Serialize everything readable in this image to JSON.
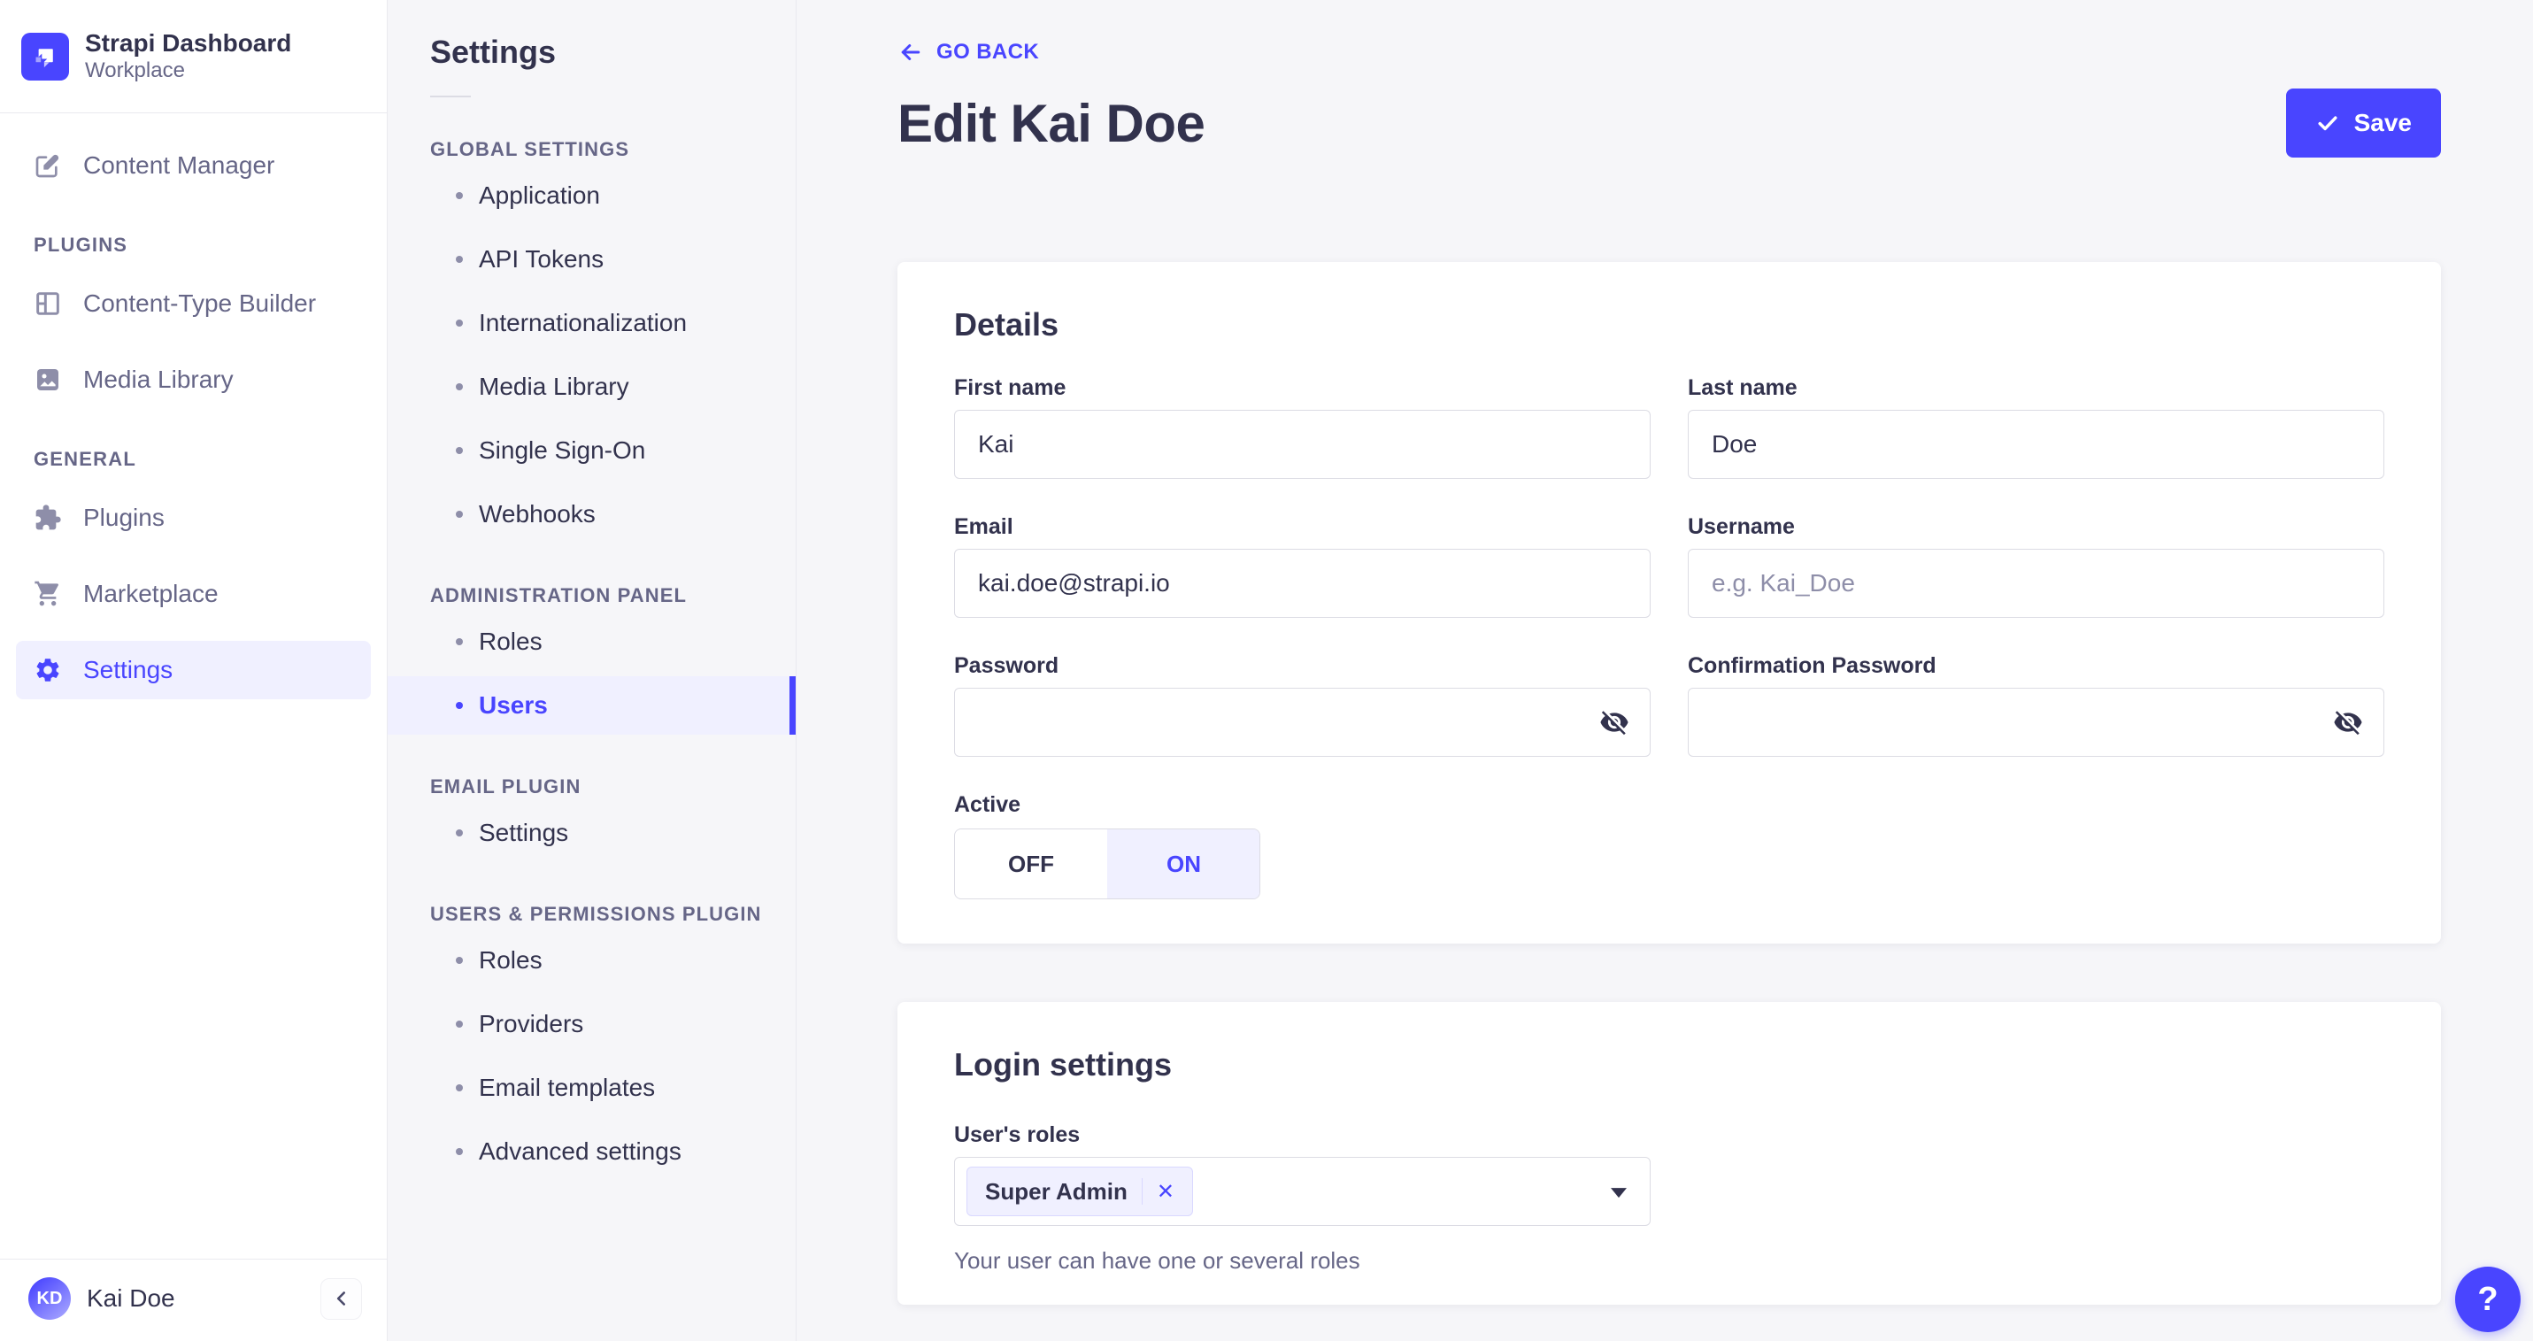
{
  "colors": {
    "primary": "#4945ff",
    "primary_light": "#f0f0ff",
    "text_dark": "#32324d",
    "text_muted": "#666687",
    "border": "#dcdce4",
    "background": "#f6f6f9"
  },
  "brand": {
    "title": "Strapi Dashboard",
    "subtitle": "Workplace"
  },
  "sidebar": {
    "content_manager": "Content Manager",
    "sections": [
      {
        "title": "PLUGINS",
        "items": [
          {
            "label": "Content-Type Builder"
          },
          {
            "label": "Media Library"
          }
        ]
      },
      {
        "title": "GENERAL",
        "items": [
          {
            "label": "Plugins"
          },
          {
            "label": "Marketplace"
          },
          {
            "label": "Settings",
            "active": true
          }
        ]
      }
    ],
    "user": {
      "initials": "KD",
      "name": "Kai Doe"
    }
  },
  "subnav": {
    "title": "Settings",
    "groups": [
      {
        "title": "GLOBAL SETTINGS",
        "items": [
          {
            "label": "Application"
          },
          {
            "label": "API Tokens"
          },
          {
            "label": "Internationalization"
          },
          {
            "label": "Media Library"
          },
          {
            "label": "Single Sign-On"
          },
          {
            "label": "Webhooks"
          }
        ]
      },
      {
        "title": "ADMINISTRATION PANEL",
        "items": [
          {
            "label": "Roles"
          },
          {
            "label": "Users",
            "active": true
          }
        ]
      },
      {
        "title": "EMAIL PLUGIN",
        "items": [
          {
            "label": "Settings"
          }
        ]
      },
      {
        "title": "USERS & PERMISSIONS PLUGIN",
        "items": [
          {
            "label": "Roles"
          },
          {
            "label": "Providers"
          },
          {
            "label": "Email templates"
          },
          {
            "label": "Advanced settings"
          }
        ]
      }
    ]
  },
  "header": {
    "back": "GO BACK",
    "title": "Edit Kai Doe",
    "save": "Save"
  },
  "details": {
    "title": "Details",
    "first_name": {
      "label": "First name",
      "value": "Kai"
    },
    "last_name": {
      "label": "Last name",
      "value": "Doe"
    },
    "email": {
      "label": "Email",
      "value": "kai.doe@strapi.io"
    },
    "username": {
      "label": "Username",
      "placeholder": "e.g. Kai_Doe"
    },
    "password": {
      "label": "Password"
    },
    "confirmation_password": {
      "label": "Confirmation Password"
    },
    "active": {
      "label": "Active",
      "off": "OFF",
      "on": "ON",
      "value": "ON"
    }
  },
  "login": {
    "title": "Login settings",
    "roles_label": "User's roles",
    "selected_roles": [
      "Super Admin"
    ],
    "helper": "Your user can have one or several roles"
  },
  "icons": {
    "close": "✕"
  },
  "fab": {
    "label": "?"
  }
}
